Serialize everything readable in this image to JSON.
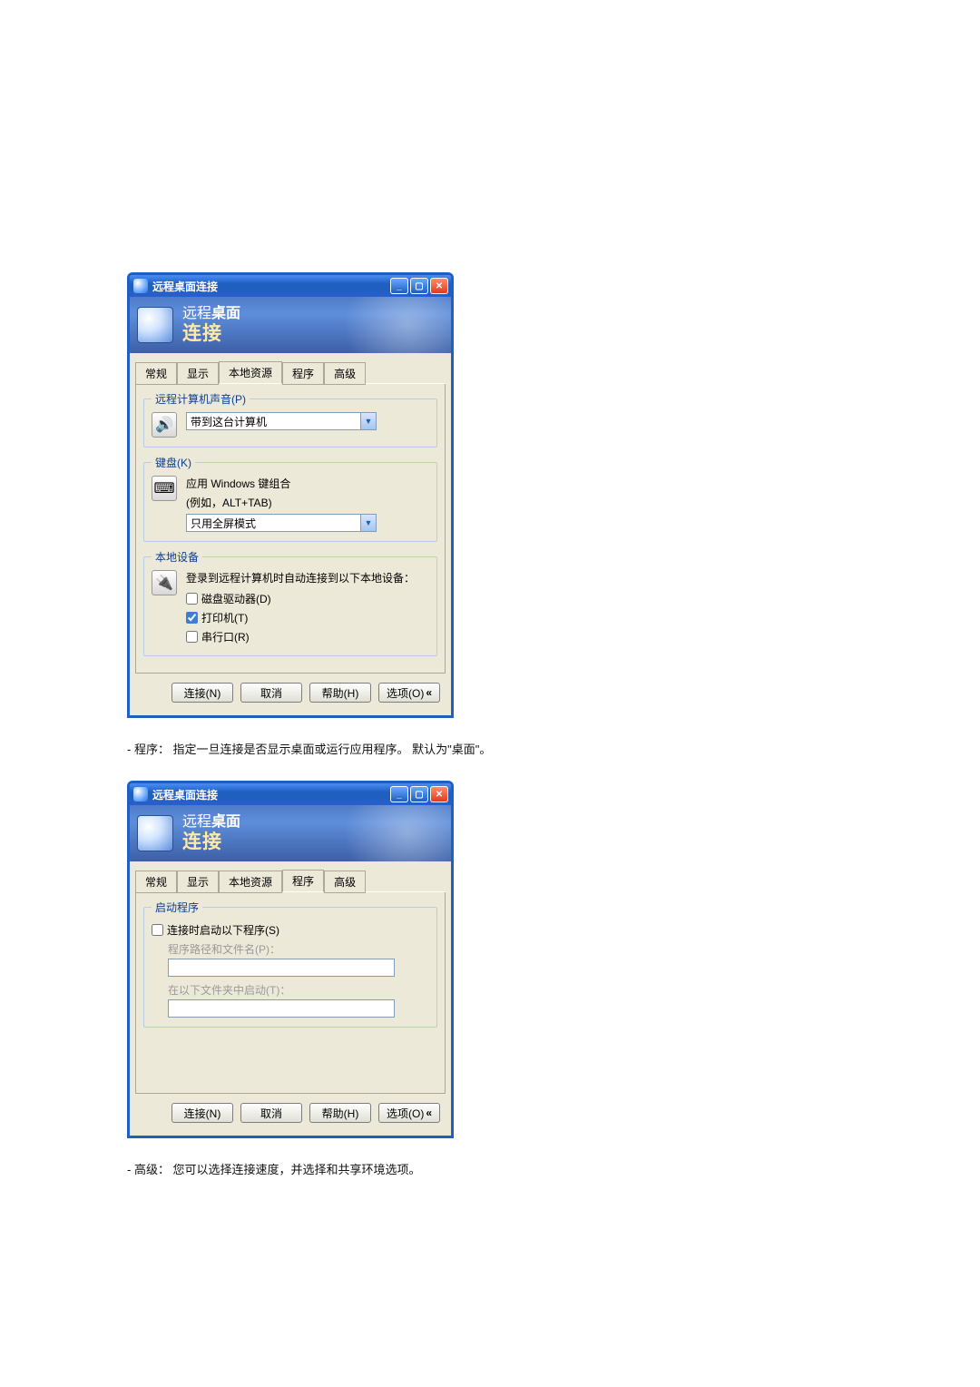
{
  "window_title": "远程桌面连接",
  "banner": {
    "line1_a": "远程",
    "line1_b": "桌面",
    "line2": "连接"
  },
  "tabs": {
    "general": "常规",
    "display": "显示",
    "local": "本地资源",
    "programs": "程序",
    "advanced": "高级"
  },
  "win1": {
    "active_tab": "local",
    "sound": {
      "legend": "远程计算机声音(P)",
      "selected": "带到这台计算机"
    },
    "keyboard": {
      "legend": "键盘(K)",
      "desc1": "应用 Windows 键组合",
      "desc2": "(例如，ALT+TAB)",
      "selected": "只用全屏模式"
    },
    "devices": {
      "legend": "本地设备",
      "intro": "登录到远程计算机时自动连接到以下本地设备：",
      "disk": "磁盘驱动器(D)",
      "printer": "打印机(T)",
      "serial": "串行口(R)"
    }
  },
  "win2": {
    "active_tab": "programs",
    "start": {
      "legend": "启动程序",
      "chk": "连接时启动以下程序(S)",
      "path_label": "程序路径和文件名(P)：",
      "folder_label": "在以下文件夹中启动(T)："
    }
  },
  "buttons": {
    "connect": "连接(N)",
    "cancel": "取消",
    "help": "帮助(H)",
    "options": "选项(O)"
  },
  "doc_line1": "- 程序： 指定一旦连接是否显示桌面或运行应用程序。 默认为\"桌面\"。",
  "doc_line2": "- 高级： 您可以选择连接速度，并选择和共享环境选项。"
}
